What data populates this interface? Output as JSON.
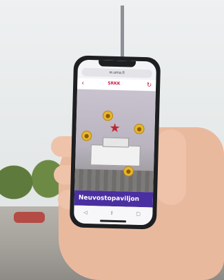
{
  "browser": {
    "url": "m.oma.fi"
  },
  "app": {
    "logo": "SRKK",
    "back_icon": "chevron-left-icon",
    "refresh_icon": "refresh-icon"
  },
  "ar_view": {
    "object": "building-model",
    "marker_icon": "red-star-icon",
    "coin_icon": "coin-icon"
  },
  "banner": {
    "title": "Neuvostopaviljon"
  },
  "bottom_bar": {
    "icons": [
      "back-nav-icon",
      "share-icon",
      "tabs-icon"
    ]
  }
}
